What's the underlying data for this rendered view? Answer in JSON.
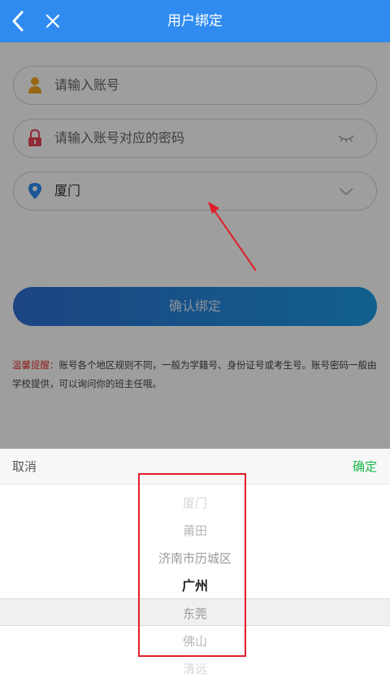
{
  "header": {
    "title": "用户绑定"
  },
  "form": {
    "account_placeholder": "请输入账号",
    "password_placeholder": "请输入账号对应的密码",
    "region_value": "厦门",
    "confirm_label": "确认绑定"
  },
  "tip": {
    "label": "温馨提醒：",
    "text": "账号各个地区规则不同，一般为学籍号、身份证号或考生号。账号密码一般由学校提供，可以询问你的班主任哦。"
  },
  "picker": {
    "cancel_label": "取消",
    "confirm_label": "确定",
    "options": [
      "厦门",
      "莆田",
      "济南市历城区",
      "广州",
      "东莞",
      "佛山",
      "清远"
    ],
    "selected": "广州"
  },
  "colors": {
    "header_bg": "#2f8bf0",
    "confirm_green": "#1ab74c",
    "annotation_red": "#e0202a"
  }
}
